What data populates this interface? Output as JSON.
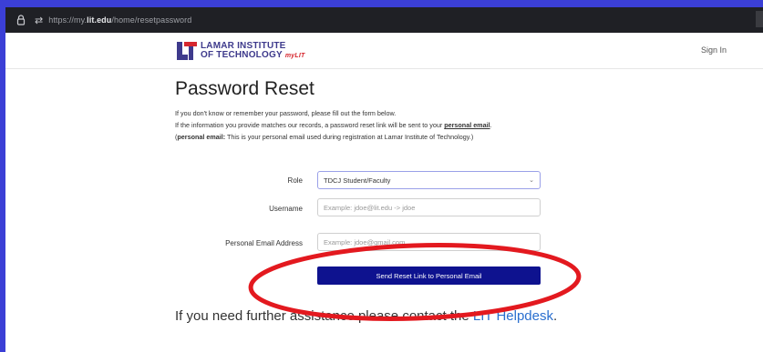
{
  "browser": {
    "url_prefix": "https://my.",
    "url_domain": "lit.edu",
    "url_path": "/home/resetpassword"
  },
  "header": {
    "logo_line1": "LAMAR INSTITUTE",
    "logo_line2": "OF TECHNOLOGY",
    "logo_sub": "myLIT",
    "signin": "Sign In"
  },
  "main": {
    "title": "Password Reset",
    "line1": "If you don't know or remember your password, please fill out the form below.",
    "line2": "If the information you provide matches our records, a password reset link will be sent to your",
    "line2_em": "personal email",
    "line2_end": ".",
    "line3_open": "(",
    "line3_label": "personal email:",
    "line3_rest": " This is your personal email used during registration at Lamar Institute of Technology.)"
  },
  "form": {
    "role_label": "Role",
    "role_value": "TDCJ Student/Faculty",
    "username_label": "Username",
    "username_placeholder": "Example: jdoe@lit.edu -> jdoe",
    "email_label": "Personal Email Address",
    "email_placeholder": "Example: jdoe@gmail.com",
    "submit": "Send Reset Link to Personal Email"
  },
  "footer": {
    "help_text": "If you need further assistance please contact the ",
    "help_link": "LIT Helpdesk",
    "help_end": "."
  },
  "colors": {
    "accent": "#0e128f",
    "annotation": "#e3191f",
    "logo": "#3e3a8c"
  }
}
